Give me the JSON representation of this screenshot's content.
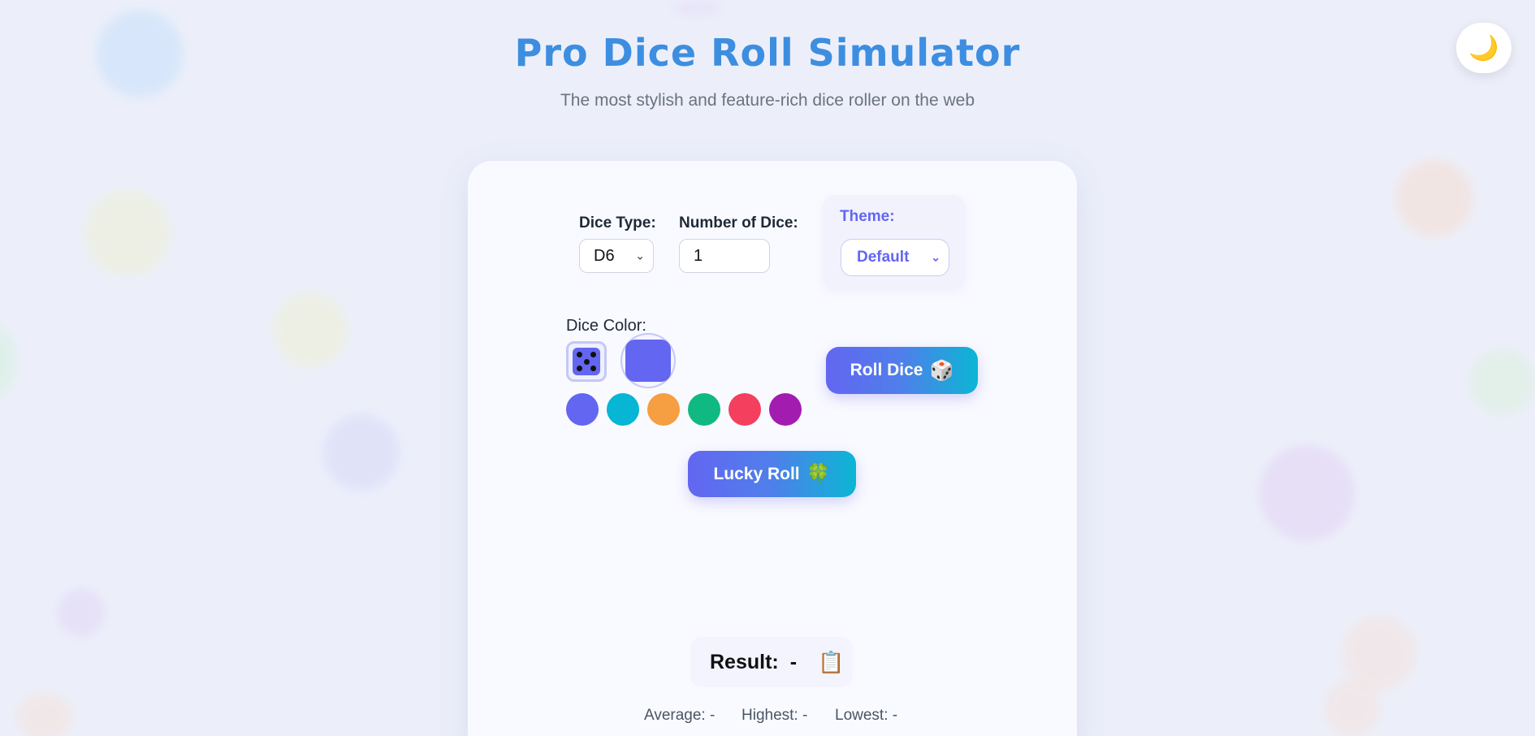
{
  "header": {
    "title": "Pro Dice Roll Simulator",
    "subtitle": "The most stylish and feature-rich dice roller on the web"
  },
  "theme_toggle": {
    "icon": "moon-icon",
    "glyph": "🌙"
  },
  "controls": {
    "dice_type_label": "Dice Type:",
    "dice_type_value": "D6",
    "number_label": "Number of Dice:",
    "number_value": "1",
    "theme_label": "Theme:",
    "theme_value": "Default"
  },
  "dice_color": {
    "label": "Dice Color:",
    "selected": "#6366f1",
    "swatches": [
      "#6366f1",
      "#06b6d4",
      "#f59e42",
      "#10b981",
      "#f43f5e",
      "#a21caf"
    ]
  },
  "buttons": {
    "roll_label": "Roll Dice",
    "roll_icon": "🎲",
    "lucky_label": "Lucky Roll",
    "lucky_icon": "🍀"
  },
  "result": {
    "label": "Result:",
    "value": "-",
    "copy_icon": "📋"
  },
  "stats": {
    "average": "Average: -",
    "highest": "Highest: -",
    "lowest": "Lowest: -"
  },
  "colors": {
    "accent": "#6366f1",
    "title": "#3d8ee0",
    "gradient_end": "#0bb6d4"
  }
}
